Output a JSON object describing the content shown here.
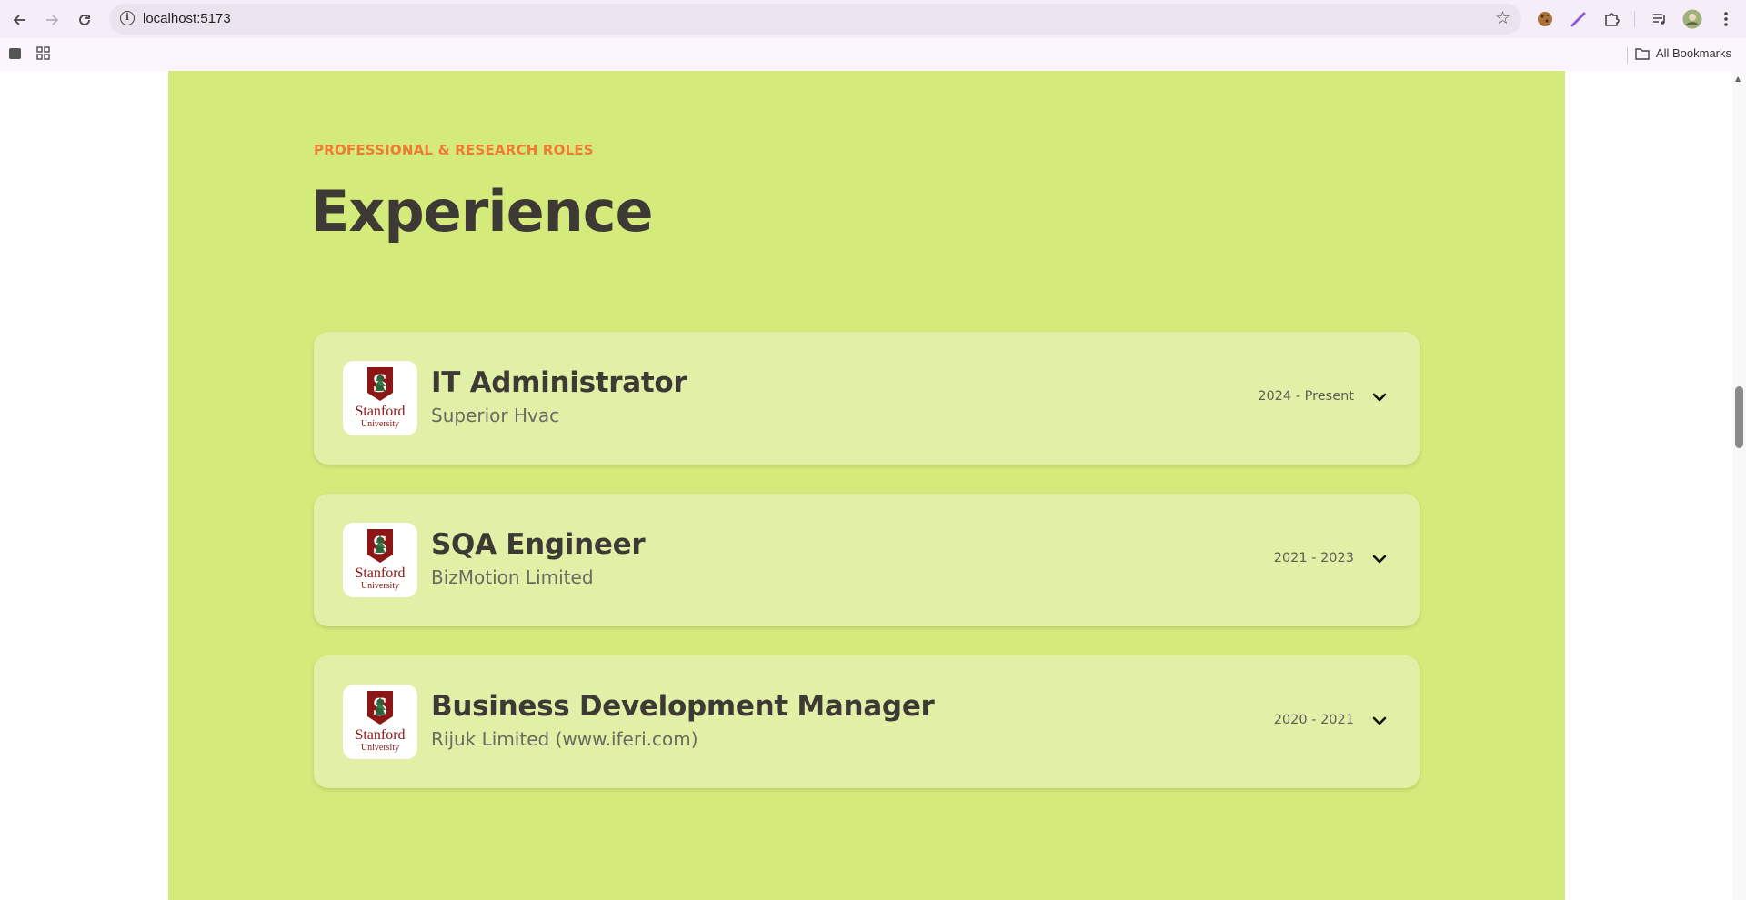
{
  "browser": {
    "url": "localhost:5173",
    "bookmarks_label": "All Bookmarks"
  },
  "section": {
    "eyebrow": "PROFESSIONAL & RESEARCH ROLES",
    "title": "Experience"
  },
  "logo": {
    "line1": "Stanford",
    "line2": "University"
  },
  "experiences": [
    {
      "role": "IT Administrator",
      "company": "Superior Hvac",
      "dates": "2024 - Present"
    },
    {
      "role": "SQA Engineer",
      "company": "BizMotion Limited",
      "dates": "2021 - 2023"
    },
    {
      "role": "Business Development Manager",
      "company": "Rijuk Limited (www.iferi.com)",
      "dates": "2020 - 2021"
    }
  ],
  "colors": {
    "section_bg": "#d4ea7a",
    "card_bg": "#e1f0a6",
    "eyebrow": "#f07a34",
    "heading": "#3d3a36",
    "stanford_red": "#8c1515"
  },
  "icons": [
    "back-icon",
    "forward-icon",
    "reload-icon",
    "info-icon",
    "star-icon",
    "cookie-icon",
    "pen-icon",
    "puzzle-icon",
    "media-icon",
    "profile-avatar",
    "menu-icon",
    "tab-icon",
    "apps-icon",
    "folder-icon",
    "chevron-down-icon"
  ]
}
